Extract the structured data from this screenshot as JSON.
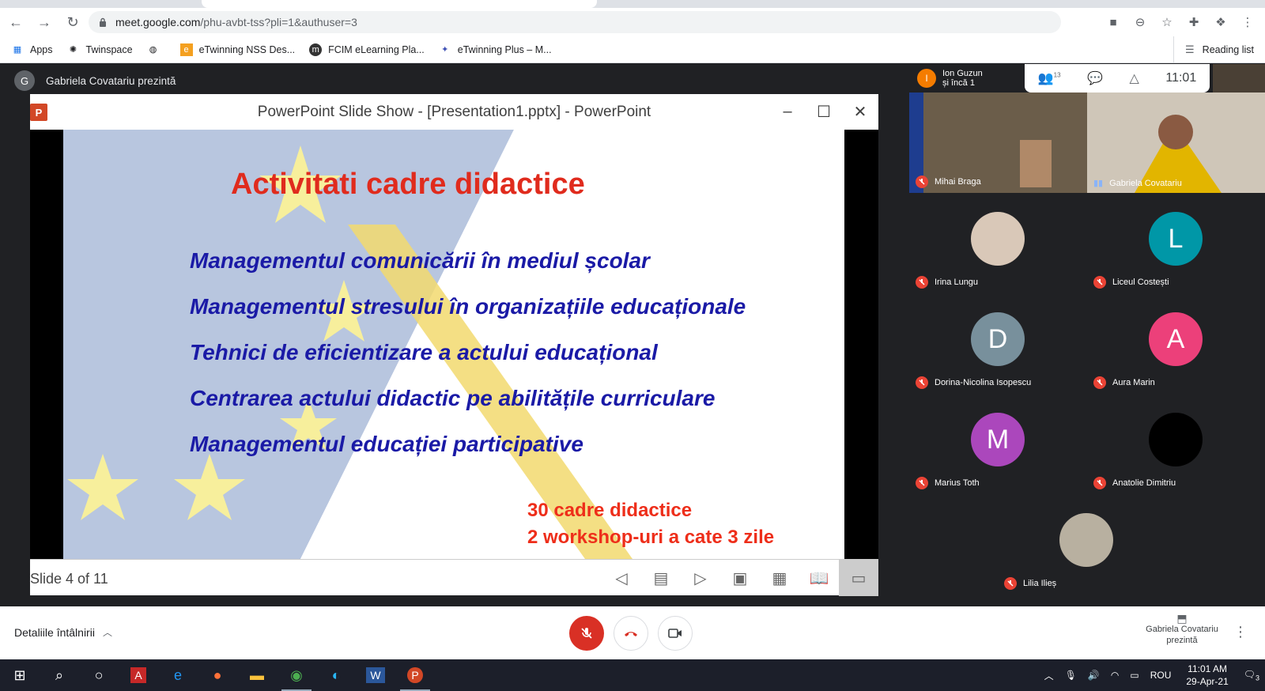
{
  "browser": {
    "url_main": "meet.google.com",
    "url_path": "/phu-avbt-tss?pli=1&authuser=3",
    "bookmarks": [
      "Apps",
      "Twinspace",
      "eTwinning NSS Des...",
      "FCIM eLearning Pla...",
      "eTwinning Plus – M..."
    ],
    "reading_list": "Reading list"
  },
  "meet": {
    "presenter_initial": "G",
    "presenter_text": "Gabriela Covatariu prezintă",
    "guest_initial": "I",
    "guest_name": "Ion Guzun",
    "guest_more": "și încă 1",
    "participants_count": "13",
    "time": "11:01",
    "details_label": "Detaliile întâlnirii",
    "presenting_label": "Gabriela Covatariu prezintă"
  },
  "ppt": {
    "window_title": "PowerPoint Slide Show - [Presentation1.pptx] - PowerPoint",
    "slide_counter": "Slide 4 of 11",
    "slide_title": "Activitati cadre didactice",
    "bullets": [
      "Managementul comunicării în mediul școlar",
      "Managementul stresului în organizațiile educaționale",
      "Tehnici de eficientizare a actului educațional",
      "Centrarea actului didactic pe abilitățile curriculare",
      "Managementul educației participative"
    ],
    "note_line1": "30 cadre didactice",
    "note_line2": "2 workshop-uri a cate 3 zile"
  },
  "participants": [
    {
      "name": "Mihai Braga",
      "initial": "",
      "color": "#7a6a55"
    },
    {
      "name": "Gabriela Covatariu",
      "initial": "",
      "color": "#c9a227"
    },
    {
      "name": "Irina Lungu",
      "initial": "",
      "color": "#d9c8b8"
    },
    {
      "name": "Liceul Costești",
      "initial": "L",
      "color": "#0097a7"
    },
    {
      "name": "Dorina-Nicolina Isopescu",
      "initial": "D",
      "color": "#78909c"
    },
    {
      "name": "Aura Marin",
      "initial": "A",
      "color": "#ec407a"
    },
    {
      "name": "Marius Toth",
      "initial": "M",
      "color": "#ab47bc"
    },
    {
      "name": "Anatolie Dimitriu",
      "initial": "",
      "color": "#000000"
    },
    {
      "name": "Lilia Ilieș",
      "initial": "",
      "color": "#b8b0a0"
    }
  ],
  "taskbar": {
    "lang": "ROU",
    "time": "11:01 AM",
    "date": "29-Apr-21",
    "notif_count": "3"
  }
}
